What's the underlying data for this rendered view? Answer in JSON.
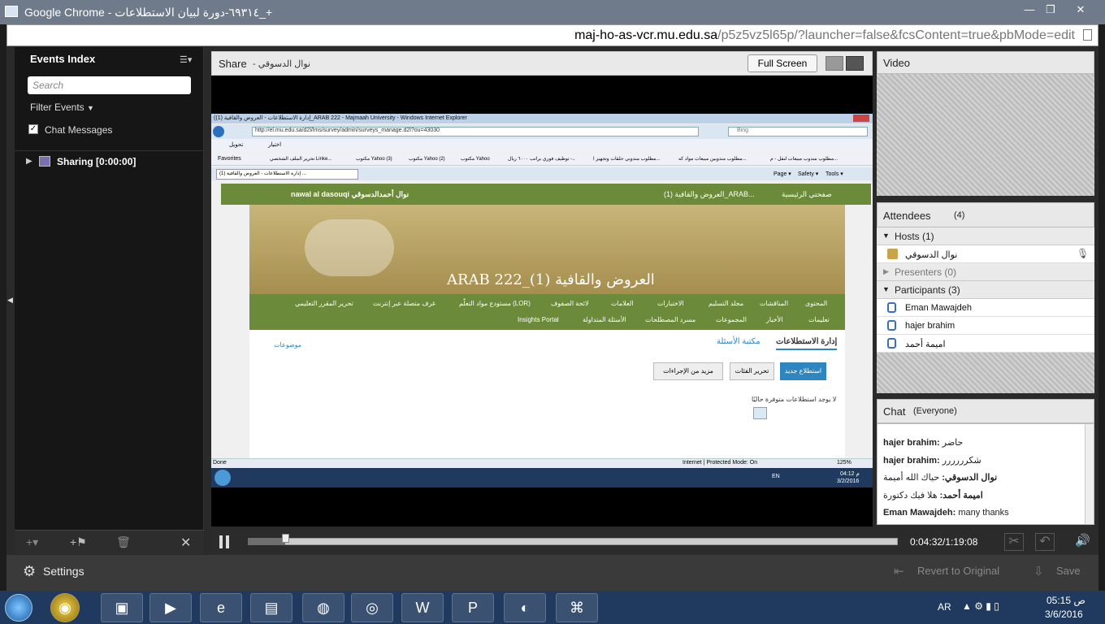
{
  "window": {
    "title": "Google Chrome - ٦٩٣١٤-دورة لبيان الاستطلاعات_+",
    "controls": [
      "—",
      "❐",
      "✕"
    ]
  },
  "address": {
    "host": "maj-ho-as-vcr.mu.edu.sa",
    "path": "/p5z5vz5l65p/?launcher=false&fcsContent=true&pbMode=edit"
  },
  "events_index": {
    "title": "Events Index",
    "search_placeholder": "Search",
    "filter_label": "Filter Events",
    "chat_messages_label": "Chat Messages",
    "sharing_label": "Sharing [0:00:00]"
  },
  "share": {
    "label": "Share",
    "presenter": "نوال الدسوقي",
    "fullscreen_label": "Full Screen"
  },
  "ie": {
    "title": "(إدارة الاستطلاعات - العروض والقافية (1)_ARAB 222 - Majmaah University - Windows Internet Explorer",
    "url": "http://el.mu.edu.sa/d2l/lms/survey/admin/surveys_manage.d2l?ou=43030",
    "search": "Bing",
    "convert_label": "تحويل",
    "select_label": "اختيار",
    "favorites_label": "Favorites",
    "fav_items": [
      "تحرير الملف الشخصي Linke...",
      "مكتوب Yahoo (3)",
      "مكتوب Yahoo (2)",
      "مكتوب Yahoo",
      "توظيف فوري براتب ٦٠٠٠ ريال -..",
      "مطلوب مندوبي حلقات وتجهيز ا...",
      "مطلوب مندوبين مبيعات مواد كه...",
      "مطلوب مندوب مبيعات لنقل - م..."
    ],
    "tab_label": "(إدارة الاستطلاعات - العروض والقافية (1 ...",
    "tools": [
      "Page ▾",
      "Safety ▾",
      "Tools ▾"
    ],
    "status_done": "Done",
    "status_zone": "Internet | Protected Mode: On",
    "zoom": "125%"
  },
  "d2l": {
    "user": "nawal al dasouqi نوال أحمدالدسوقي",
    "home": "صفحتي الرئيسية",
    "breadcrumb": "العروض والقافية (1)_ARAB...",
    "course_title": "ARAB 222_(1) العروض والقافية",
    "nav1": [
      "المحتوى",
      "المناقشات",
      "مجلد التسليم",
      "الاختبارات",
      "العلامات",
      "لائحة الصفوف",
      "مستودع مواد التعلّم (LOR)",
      "غرف متصلة عبر إنترنت",
      "تحرير المقرر التعليمي"
    ],
    "nav2": [
      "تعليمات",
      "الأخبار",
      "المجموعات",
      "مسرد المصطلحات",
      "الأسئلة المتداولة",
      "Insights Portal"
    ],
    "tab_manage": "إدارة الاستطلاعات",
    "tab_library": "مكتبة الأسئلة",
    "topics": "موضوعات",
    "new_btn": "استطلاع جديد",
    "edit_cat_btn": "تحرير الفئات",
    "more_btn": "مزيد من الإجراءات",
    "empty_msg": "لا يوجد استطلاعات متوفرة حاليًا"
  },
  "inner_taskbar": {
    "lang": "EN",
    "time": "04:12 م",
    "date": "3/2/2016"
  },
  "video": {
    "title": "Video"
  },
  "attendees": {
    "title": "Attendees",
    "count": "(4)",
    "hosts_label": "Hosts (1)",
    "presenters_label": "Presenters (0)",
    "participants_label": "Participants (3)",
    "hosts": [
      "نوال الدسوقي"
    ],
    "participants": [
      "Eman Mawajdeh",
      "hajer brahim",
      "اميمة أحمد"
    ]
  },
  "chat": {
    "title": "Chat",
    "scope": "(Everyone)",
    "messages": [
      {
        "sender": "hajer brahim:",
        "text": "حاضر"
      },
      {
        "sender": "hajer brahim:",
        "text": "شكرررررر"
      },
      {
        "sender": "نوال الدسوقي:",
        "text": "حياك الله أميمة"
      },
      {
        "sender": "اميمة أحمد:",
        "text": "هلا فيك دكتورة"
      },
      {
        "sender": "Eman Mawajdeh:",
        "text": "many thanks"
      }
    ]
  },
  "player": {
    "time": "0:04:32/1:19:08",
    "progress": 0.058
  },
  "settings": {
    "label": "Settings",
    "revert_label": "Revert to Original",
    "save_label": "Save"
  },
  "taskbar": {
    "lang": "AR",
    "time": "05:15 ص",
    "date": "3/6/2016"
  },
  "colors": {
    "d2l_green": "#6b8a3a",
    "chat_blue": "#1f3a5e",
    "primary_btn": "#2e86c1"
  }
}
